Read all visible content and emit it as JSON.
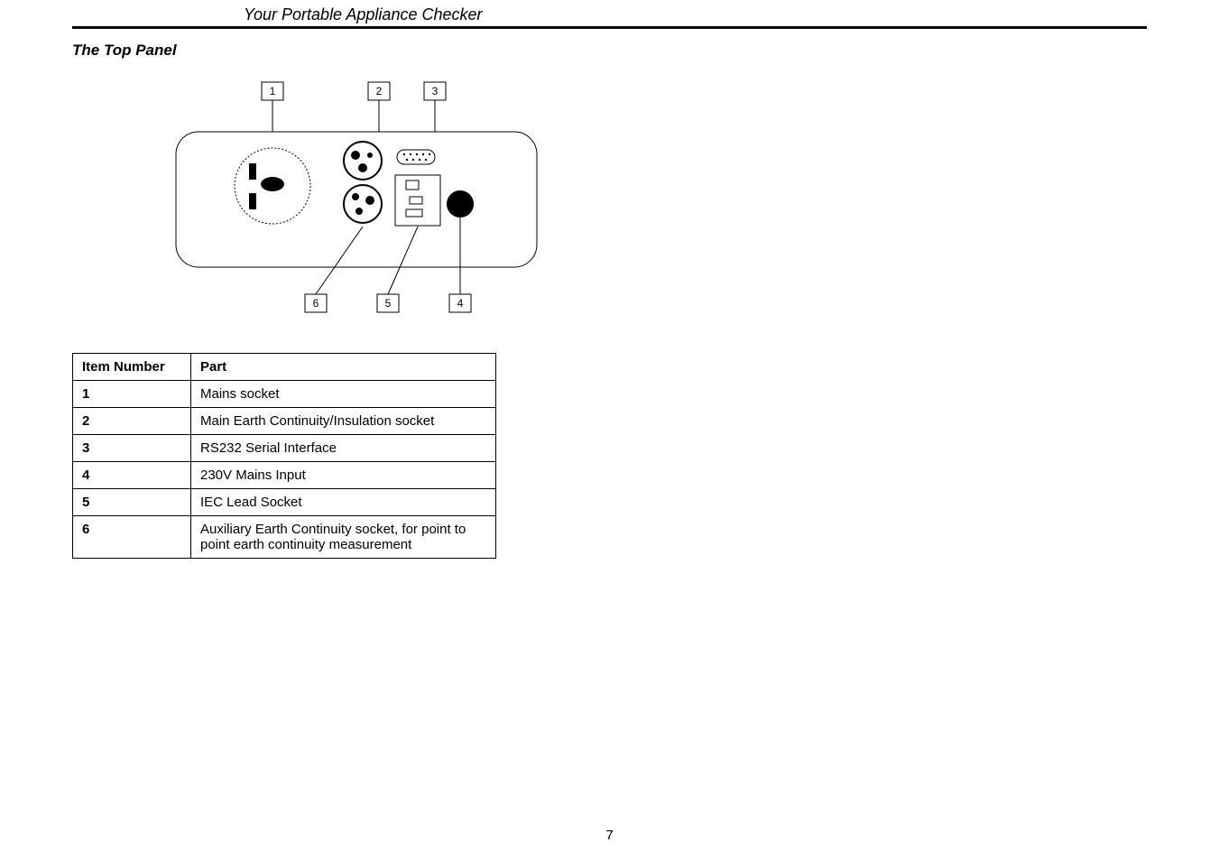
{
  "header_title": "Your Portable Appliance Checker",
  "section_title": "The Top Panel",
  "diagram_labels": {
    "l1": "1",
    "l2": "2",
    "l3": "3",
    "l4": "4",
    "l5": "5",
    "l6": "6"
  },
  "table": {
    "head_item": "Item Number",
    "head_part": "Part",
    "rows": [
      {
        "num": "1",
        "part": "Mains socket"
      },
      {
        "num": "2",
        "part": "Main Earth Continuity/Insulation socket"
      },
      {
        "num": "3",
        "part": "RS232 Serial Interface"
      },
      {
        "num": "4",
        "part": "230V Mains Input"
      },
      {
        "num": "5",
        "part": "IEC Lead Socket"
      },
      {
        "num": "6",
        "part": "Auxiliary Earth Continuity socket, for point to point earth continuity measurement"
      }
    ]
  },
  "page_number": "7"
}
